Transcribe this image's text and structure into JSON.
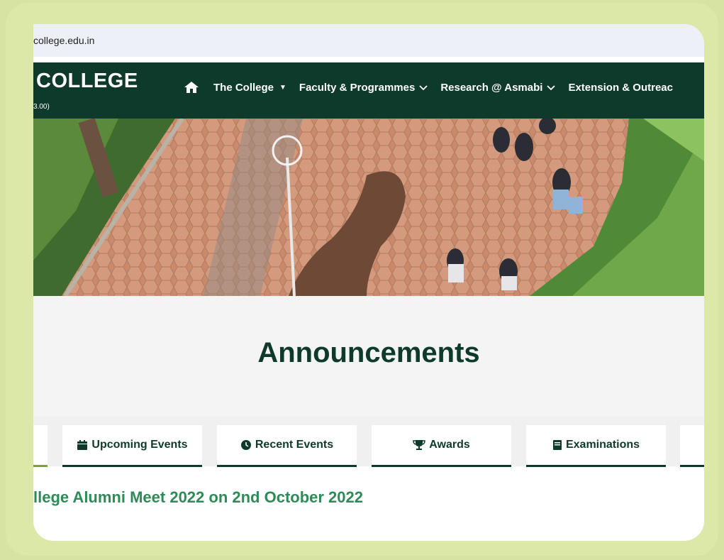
{
  "browser": {
    "url": "college.edu.in"
  },
  "header": {
    "logo_text": "COLLEGE",
    "logo_sub": "3.00)",
    "nav": [
      {
        "label": "The College",
        "icon": "caret-down-icon"
      },
      {
        "label": "Faculty & Programmes",
        "icon": "chevron-down-icon"
      },
      {
        "label": "Research @ Asmabi",
        "icon": "chevron-down-icon"
      },
      {
        "label": "Extension & Outreac",
        "icon": ""
      }
    ]
  },
  "announcements": {
    "title": "Announcements",
    "tabs": [
      {
        "label": "Upcoming Events",
        "icon": "calendar-icon"
      },
      {
        "label": "Recent Events",
        "icon": "clock-icon"
      },
      {
        "label": "Awards",
        "icon": "trophy-icon"
      },
      {
        "label": "Examinations",
        "icon": "book-icon"
      }
    ],
    "headline": "llege Alumni Meet 2022 on 2nd October 2022"
  },
  "colors": {
    "brand_dark": "#0e3a2c",
    "accent_green": "#2e8b57",
    "frame": "#d7e3a3"
  }
}
